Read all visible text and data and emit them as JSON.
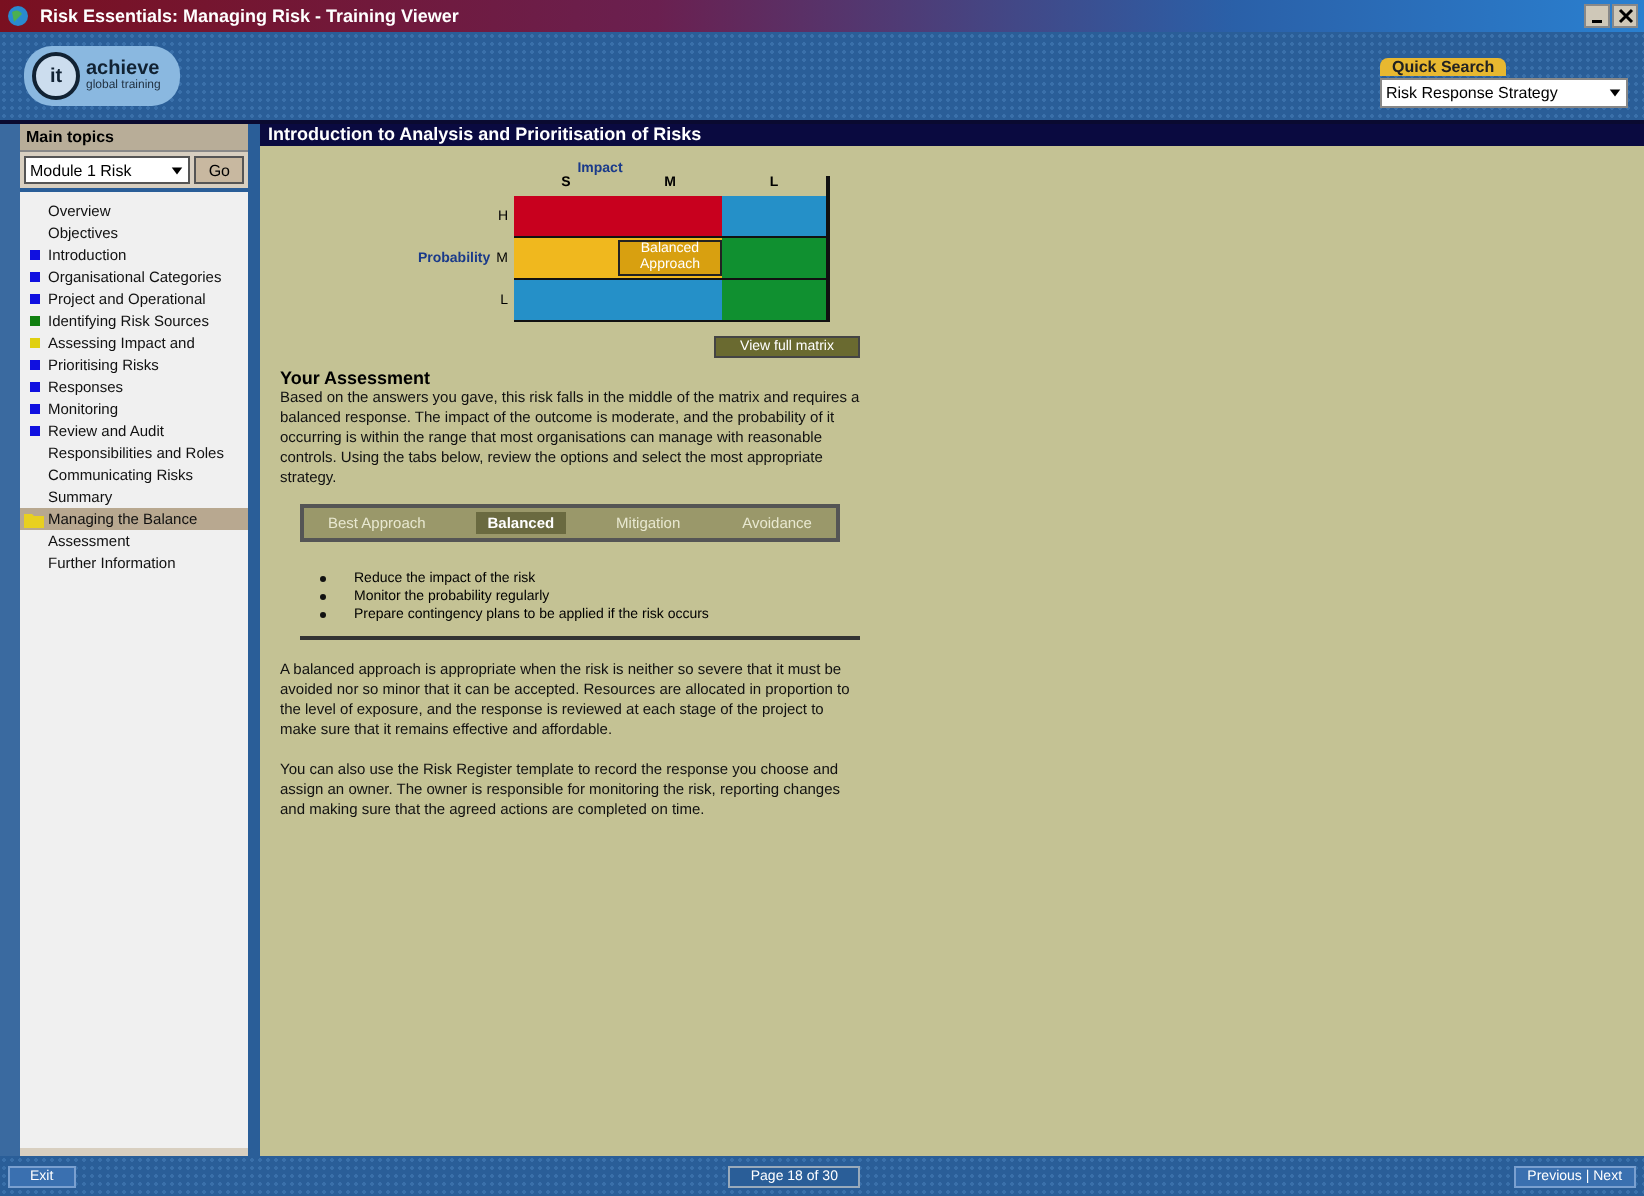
{
  "window": {
    "title": "Risk Essentials: Managing Risk - Training Viewer"
  },
  "header": {
    "logo_mark": "it",
    "logo_text": "achieve",
    "logo_sub": "global training",
    "search_label": "Quick Search",
    "search_value": "Risk Response Strategy"
  },
  "sidebar": {
    "heading": "Main topics",
    "select_value": "Module 1 Risk",
    "go_label": "Go",
    "items": [
      {
        "label": "Overview",
        "selected": false
      },
      {
        "label": "Objectives",
        "selected": false
      },
      {
        "label": "Introduction",
        "color": "#1010e0",
        "selected": false
      },
      {
        "label": "Organisational Categories",
        "color": "#1010e0",
        "selected": false
      },
      {
        "label": "Project and Operational",
        "color": "#1010e0",
        "selected": false
      },
      {
        "label": "Identifying Risk Sources",
        "color": "#108010",
        "selected": false
      },
      {
        "label": "Assessing Impact and",
        "color": "#e0d010",
        "selected": false
      },
      {
        "label": "Prioritising Risks",
        "color": "#1010e0",
        "selected": false
      },
      {
        "label": "Responses",
        "color": "#1010e0",
        "selected": false
      },
      {
        "label": "Monitoring",
        "color": "#1010e0",
        "selected": false
      },
      {
        "label": "Review and Audit",
        "color": "#1010e0",
        "selected": false
      },
      {
        "label": "Responsibilities and Roles",
        "selected": false
      },
      {
        "label": "Communicating Risks",
        "selected": false
      },
      {
        "label": "Summary",
        "selected": false
      },
      {
        "label": "Managing the Balance",
        "selected": true
      },
      {
        "label": "Assessment",
        "selected": false
      },
      {
        "label": "Further Information",
        "selected": false
      }
    ]
  },
  "content": {
    "title": "Introduction to Analysis and Prioritisation of Risks",
    "matrix": {
      "top_axis": "Impact",
      "side_axis": "Probability",
      "columns": [
        "S",
        "M",
        "L"
      ],
      "rows": [
        "H",
        "M",
        "L"
      ],
      "cells": [
        {
          "color": "#c8001e"
        },
        {
          "color": "#c8001e"
        },
        {
          "color": "#2590c8"
        },
        {
          "color": "#f0b81e"
        },
        {
          "color": "#f0b81e",
          "label": "Balanced Approach"
        },
        {
          "color": "#109030"
        },
        {
          "color": "#2590c8"
        },
        {
          "color": "#2590c8"
        },
        {
          "color": "#109030"
        }
      ],
      "button": "View full matrix"
    },
    "section_heading": "Your Assessment",
    "intro": "Based on the answers you gave, this risk falls in the middle of the matrix and requires a balanced response. The impact of the outcome is moderate, and the probability of it occurring is within the range that most organisations can manage with reasonable controls. Using the tabs below, review the options and select the most appropriate strategy.",
    "tabs": [
      {
        "label": "Best Approach",
        "selected": false
      },
      {
        "label": "Balanced",
        "selected": true
      },
      {
        "label": "Mitigation",
        "selected": false
      },
      {
        "label": "Avoidance",
        "selected": false
      }
    ],
    "bullets": [
      "Reduce the impact of the risk",
      "Monitor the probability regularly",
      "Prepare contingency plans to be applied if the risk occurs"
    ],
    "paragraphs": [
      "A balanced approach is appropriate when the risk is neither so severe that it must be avoided nor so minor that it can be accepted. Resources are allocated in proportion to the level of exposure, and the response is reviewed at each stage of the project to make sure that it remains effective and affordable.",
      "You can also use the Risk Register template to record the response you choose and assign an owner. The owner is responsible for monitoring the risk, reporting changes and making sure that the agreed actions are completed on time."
    ]
  },
  "status": {
    "exit": "Exit",
    "page": "Page 18 of 30",
    "nav": "Previous | Next"
  }
}
